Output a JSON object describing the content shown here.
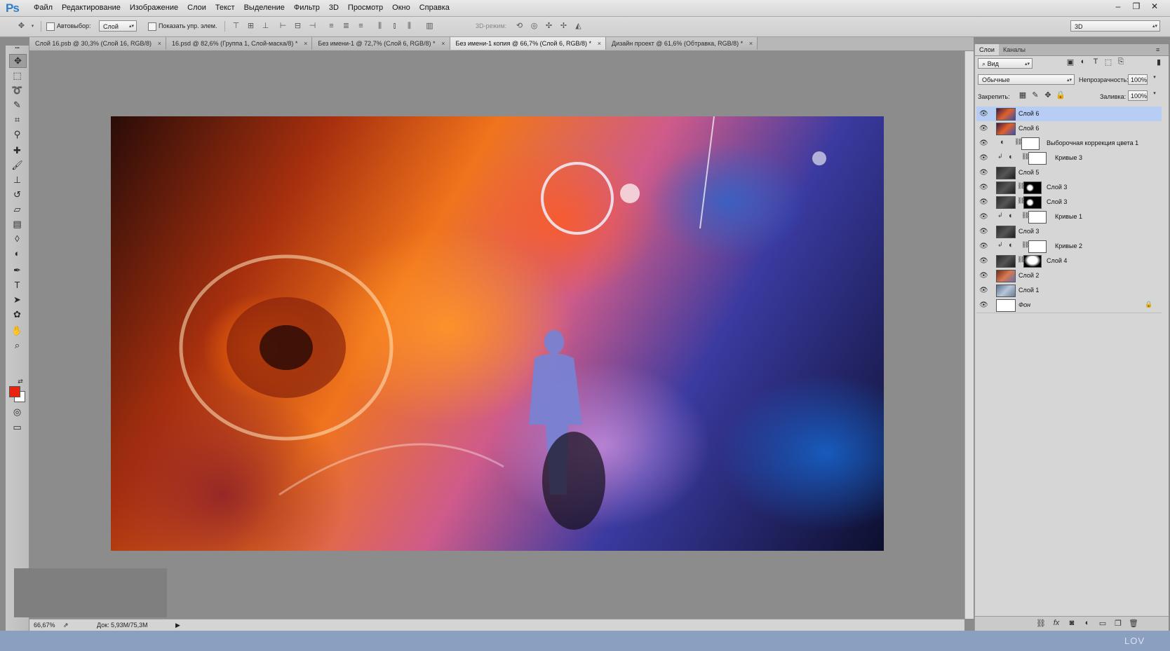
{
  "app": {
    "logo": "Ps"
  },
  "menu": [
    "Файл",
    "Редактирование",
    "Изображение",
    "Слои",
    "Текст",
    "Выделение",
    "Фильтр",
    "3D",
    "Просмотр",
    "Окно",
    "Справка"
  ],
  "window_controls": {
    "minimize": "–",
    "restore": "❐",
    "close": "✕"
  },
  "options_bar": {
    "autoselect_label": "Автовыбор:",
    "autoselect_value": "Слой",
    "show_transform_label": "Показать упр. элем.",
    "mode3d_label": "3D-режим:",
    "workspace_value": "3D"
  },
  "tabs": [
    {
      "label": "Слой 16.psb @ 30,3% (Слой 16, RGB/8)",
      "close": "×",
      "active": false
    },
    {
      "label": "16.psd @ 82,6% (Группа 1, Слой-маска/8) *",
      "close": "×",
      "active": false
    },
    {
      "label": "Без имени-1 @ 72,7% (Слой 6, RGB/8) *",
      "close": "×",
      "active": false
    },
    {
      "label": "Без имени-1 копия @ 66,7% (Слой 6, RGB/8) *",
      "close": "×",
      "active": true
    },
    {
      "label": "Дизайн проект @ 61,6% (Обтравка, RGB/8) *",
      "close": "×",
      "active": false
    }
  ],
  "tools": [
    {
      "name": "move-tool",
      "glyph": "✥"
    },
    {
      "name": "marquee-tool",
      "glyph": "⬚"
    },
    {
      "name": "lasso-tool",
      "glyph": "➰"
    },
    {
      "name": "quick-select-tool",
      "glyph": "✎"
    },
    {
      "name": "crop-tool",
      "glyph": "⌗"
    },
    {
      "name": "eyedropper-tool",
      "glyph": "⚲"
    },
    {
      "name": "healing-brush-tool",
      "glyph": "✚"
    },
    {
      "name": "brush-tool",
      "glyph": "🖌"
    },
    {
      "name": "stamp-tool",
      "glyph": "⊥"
    },
    {
      "name": "history-brush-tool",
      "glyph": "↺"
    },
    {
      "name": "eraser-tool",
      "glyph": "▱"
    },
    {
      "name": "gradient-tool",
      "glyph": "▤"
    },
    {
      "name": "blur-tool",
      "glyph": "◊"
    },
    {
      "name": "dodge-tool",
      "glyph": "◐"
    },
    {
      "name": "pen-tool",
      "glyph": "✒"
    },
    {
      "name": "type-tool",
      "glyph": "T"
    },
    {
      "name": "path-select-tool",
      "glyph": "➤"
    },
    {
      "name": "shape-tool",
      "glyph": "✿"
    },
    {
      "name": "hand-tool",
      "glyph": "✋"
    },
    {
      "name": "zoom-tool",
      "glyph": "⌕"
    }
  ],
  "colors": {
    "foreground": "#e8230f",
    "background": "#ffffff",
    "selected_layer": "#b7cdf4",
    "bottom_strip": "#8ba0c0"
  },
  "status": {
    "zoom": "66,67%",
    "doc": "Док: 5,93M/75,3M"
  },
  "watermark": "LOV",
  "panel": {
    "tabs": [
      "Слои",
      "Каналы"
    ],
    "filter_value": "Вид",
    "blend_mode": "Обычные",
    "opacity_label": "Непрозрачность:",
    "opacity_value": "100%",
    "lock_label": "Закрепить:",
    "fill_label": "Заливка:",
    "fill_value": "100%",
    "layers": [
      {
        "name": "Слой 6",
        "selected": true,
        "thumb": "photo1"
      },
      {
        "name": "Слой 6",
        "selected": false,
        "thumb": "photo1"
      },
      {
        "name": "Выборочная коррекция цвета 1",
        "selected": false,
        "thumb": "adj"
      },
      {
        "name": "Кривые 3",
        "selected": false,
        "thumb": "adj-clip"
      },
      {
        "name": "Слой 5",
        "selected": false,
        "thumb": "dark"
      },
      {
        "name": "Слой 3",
        "selected": false,
        "thumb": "masked"
      },
      {
        "name": "Слой 3",
        "selected": false,
        "thumb": "masked"
      },
      {
        "name": "Кривые 1",
        "selected": false,
        "thumb": "adj-clip"
      },
      {
        "name": "Слой 3",
        "selected": false,
        "thumb": "dark"
      },
      {
        "name": "Кривые 2",
        "selected": false,
        "thumb": "adj-clip"
      },
      {
        "name": "Слой 4",
        "selected": false,
        "thumb": "masked-white"
      },
      {
        "name": "Слой 2",
        "selected": false,
        "thumb": "photo2"
      },
      {
        "name": "Слой 1",
        "selected": false,
        "thumb": "photo3"
      },
      {
        "name": "Фон",
        "selected": false,
        "thumb": "white",
        "locked": true
      }
    ]
  }
}
